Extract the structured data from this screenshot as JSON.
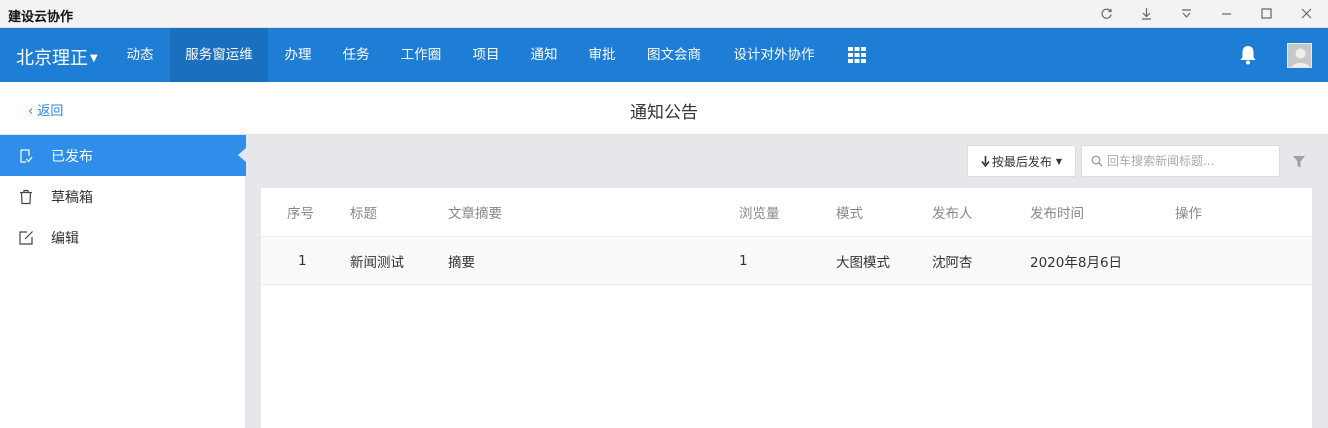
{
  "window": {
    "title": "建设云协作"
  },
  "navbar": {
    "brand": "北京理正",
    "items": [
      {
        "label": "动态"
      },
      {
        "label": "服务窗运维"
      },
      {
        "label": "办理"
      },
      {
        "label": "任务"
      },
      {
        "label": "工作圈"
      },
      {
        "label": "项目"
      },
      {
        "label": "通知"
      },
      {
        "label": "审批"
      },
      {
        "label": "图文会商"
      },
      {
        "label": "设计对外协作"
      }
    ],
    "active_index": 1,
    "color": "#1e7ed6"
  },
  "subheader": {
    "back_label": "返回",
    "page_title": "通知公告"
  },
  "sidebar": {
    "items": [
      {
        "label": "已发布",
        "icon": "published-icon"
      },
      {
        "label": "草稿箱",
        "icon": "trash-icon"
      },
      {
        "label": "编辑",
        "icon": "edit-icon"
      }
    ],
    "active_index": 0,
    "active_color": "#2f8eea"
  },
  "toolbar": {
    "sort_label": "按最后发布",
    "search_placeholder": "回车搜索新闻标题..."
  },
  "table": {
    "columns": [
      "序号",
      "标题",
      "文章摘要",
      "浏览量",
      "模式",
      "发布人",
      "发布时间",
      "操作"
    ],
    "rows": [
      [
        "1",
        "新闻测试",
        "摘要",
        "1",
        "大图模式",
        "沈阿杏",
        "2020年8月6日",
        ""
      ]
    ]
  }
}
